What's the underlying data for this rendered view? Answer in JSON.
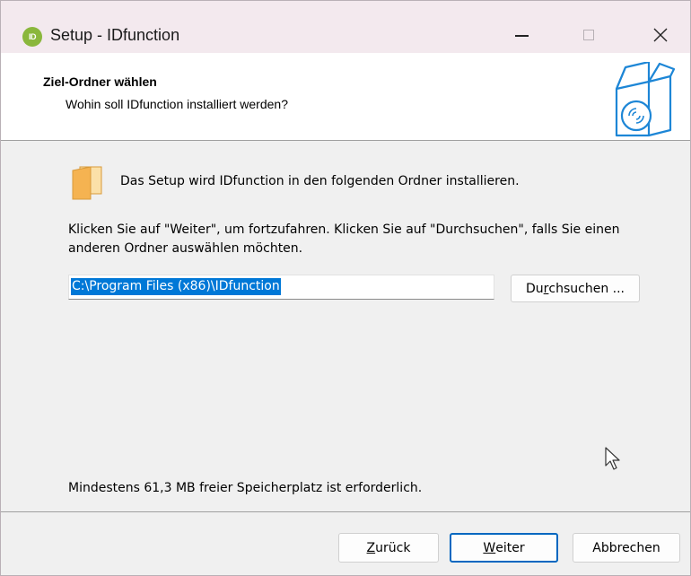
{
  "window": {
    "title": "Setup - IDfunction",
    "app_icon_text": "ID",
    "minimize_icon": "minimize-icon",
    "maximize_icon": "maximize-icon",
    "close_icon": "close-icon"
  },
  "header": {
    "title": "Ziel-Ordner wählen",
    "subtitle": "Wohin soll IDfunction installiert werden?",
    "icon": "setup-box-icon"
  },
  "content": {
    "folder_icon": "folder-icon",
    "intro": "Das Setup wird IDfunction in den folgenden Ordner installieren.",
    "instruction": "Klicken Sie auf \"Weiter\", um fortzufahren. Klicken Sie auf \"Durchsuchen\", falls Sie einen anderen Ordner auswählen möchten.",
    "path_value": "C:\\Program Files (x86)\\IDfunction",
    "browse_prefix": "Du",
    "browse_accel": "r",
    "browse_suffix": "chsuchen ...",
    "disk_space": "Mindestens 61,3 MB freier Speicherplatz ist erforderlich."
  },
  "footer": {
    "back_accel": "Z",
    "back_rest": "urück",
    "next_accel": "W",
    "next_rest": "eiter",
    "cancel": "Abbrechen"
  },
  "colors": {
    "selection": "#0078d7",
    "default_button_border": "#0067c0",
    "app_icon": "#8ab73c",
    "folder": "#f5b351",
    "box_icon": "#1d86d6"
  }
}
